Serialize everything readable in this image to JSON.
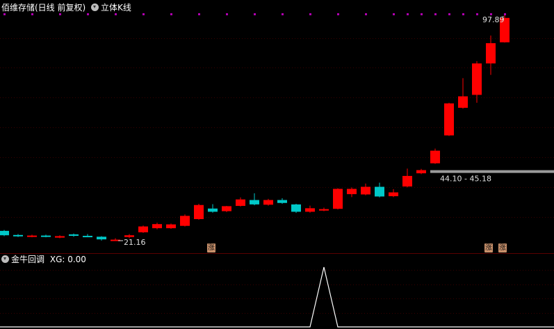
{
  "header": {
    "title": "佰维存储(日线 前复权)",
    "indicator": "立体K线"
  },
  "sub_header": {
    "indicator": "金牛回调",
    "value_text": "XG: 0.00"
  },
  "tags": {
    "left": "涨",
    "right1": "涨",
    "right2": "涨"
  },
  "colors": {
    "up": "#ff0000",
    "down": "#00c8c8",
    "grid": "#3a0000",
    "marker": "#b000b0",
    "support": "#9a9a9a",
    "tag_bg": "#c8906a"
  },
  "chart_data": [
    {
      "type": "candlestick",
      "title": "佰维存储(日线 前复权)",
      "annotations": {
        "high_label": "97.89",
        "low_label": "21.16",
        "range_label": "44.10 - 45.18"
      },
      "support_level": 45.18,
      "ylim": [
        18,
        101
      ],
      "candles": [
        {
          "o": 24.5,
          "c": 23.0,
          "h": 24.8,
          "l": 22.7
        },
        {
          "o": 23.1,
          "c": 22.7,
          "h": 23.4,
          "l": 22.4
        },
        {
          "o": 22.6,
          "c": 22.9,
          "h": 23.2,
          "l": 22.3
        },
        {
          "o": 22.9,
          "c": 22.6,
          "h": 23.2,
          "l": 22.3
        },
        {
          "o": 22.2,
          "c": 22.7,
          "h": 23.0,
          "l": 22.0
        },
        {
          "o": 23.3,
          "c": 22.8,
          "h": 23.6,
          "l": 22.5
        },
        {
          "o": 22.8,
          "c": 22.7,
          "h": 23.4,
          "l": 22.4
        },
        {
          "o": 22.5,
          "c": 21.6,
          "h": 22.7,
          "l": 21.2
        },
        {
          "o": 21.4,
          "c": 21.5,
          "h": 22.0,
          "l": 21.16
        },
        {
          "o": 22.4,
          "c": 23.0,
          "h": 23.4,
          "l": 22.0
        },
        {
          "o": 24.0,
          "c": 26.0,
          "h": 26.3,
          "l": 23.8
        },
        {
          "o": 25.4,
          "c": 26.8,
          "h": 27.3,
          "l": 25.0
        },
        {
          "o": 25.4,
          "c": 26.7,
          "h": 27.0,
          "l": 25.2
        },
        {
          "o": 26.2,
          "c": 29.6,
          "h": 30.1,
          "l": 26.0
        },
        {
          "o": 28.5,
          "c": 33.3,
          "h": 33.7,
          "l": 28.3
        },
        {
          "o": 32.1,
          "c": 31.0,
          "h": 33.6,
          "l": 30.7
        },
        {
          "o": 31.2,
          "c": 32.9,
          "h": 33.0,
          "l": 30.9
        },
        {
          "o": 33.0,
          "c": 35.2,
          "h": 35.9,
          "l": 32.8
        },
        {
          "o": 35.0,
          "c": 33.5,
          "h": 37.3,
          "l": 33.2
        },
        {
          "o": 33.4,
          "c": 35.0,
          "h": 35.4,
          "l": 33.1
        },
        {
          "o": 35.0,
          "c": 34.0,
          "h": 35.6,
          "l": 33.7
        },
        {
          "o": 33.5,
          "c": 31.0,
          "h": 33.7,
          "l": 30.6
        },
        {
          "o": 31.0,
          "c": 32.2,
          "h": 33.1,
          "l": 30.7
        },
        {
          "o": 31.4,
          "c": 31.9,
          "h": 32.4,
          "l": 31.2
        },
        {
          "o": 32.0,
          "c": 38.8,
          "h": 39.0,
          "l": 31.8
        },
        {
          "o": 37.0,
          "c": 38.8,
          "h": 39.3,
          "l": 36.0
        },
        {
          "o": 36.9,
          "c": 39.5,
          "h": 40.6,
          "l": 36.6
        },
        {
          "o": 39.5,
          "c": 36.2,
          "h": 40.9,
          "l": 35.9
        },
        {
          "o": 36.3,
          "c": 37.6,
          "h": 38.7,
          "l": 36.0
        },
        {
          "o": 39.6,
          "c": 43.2,
          "h": 45.7,
          "l": 39.3
        },
        {
          "o": 44.1,
          "c": 45.18,
          "h": 45.6,
          "l": 43.8
        },
        {
          "o": 47.5,
          "c": 51.8,
          "h": 52.5,
          "l": 47.3
        },
        {
          "o": 57.0,
          "c": 67.9,
          "h": 68.1,
          "l": 56.8
        },
        {
          "o": 66.4,
          "c": 70.3,
          "h": 76.5,
          "l": 66.1
        },
        {
          "o": 70.8,
          "c": 81.5,
          "h": 82.3,
          "l": 68.1
        },
        {
          "o": 81.5,
          "c": 88.4,
          "h": 91.0,
          "l": 77.6
        },
        {
          "o": 88.7,
          "c": 97.0,
          "h": 97.89,
          "l": 88.6
        }
      ]
    },
    {
      "type": "line",
      "title": "金牛回调",
      "series": [
        {
          "name": "XG",
          "values": [
            0,
            0,
            0,
            0,
            0,
            0,
            0,
            0,
            0,
            0,
            0,
            0,
            0,
            0,
            0,
            0,
            0,
            0,
            0,
            0,
            0,
            0,
            0,
            1,
            0,
            0,
            0,
            0,
            0,
            0,
            0,
            0,
            0,
            0,
            0,
            0,
            0
          ]
        }
      ],
      "ylim": [
        0,
        1
      ]
    }
  ]
}
